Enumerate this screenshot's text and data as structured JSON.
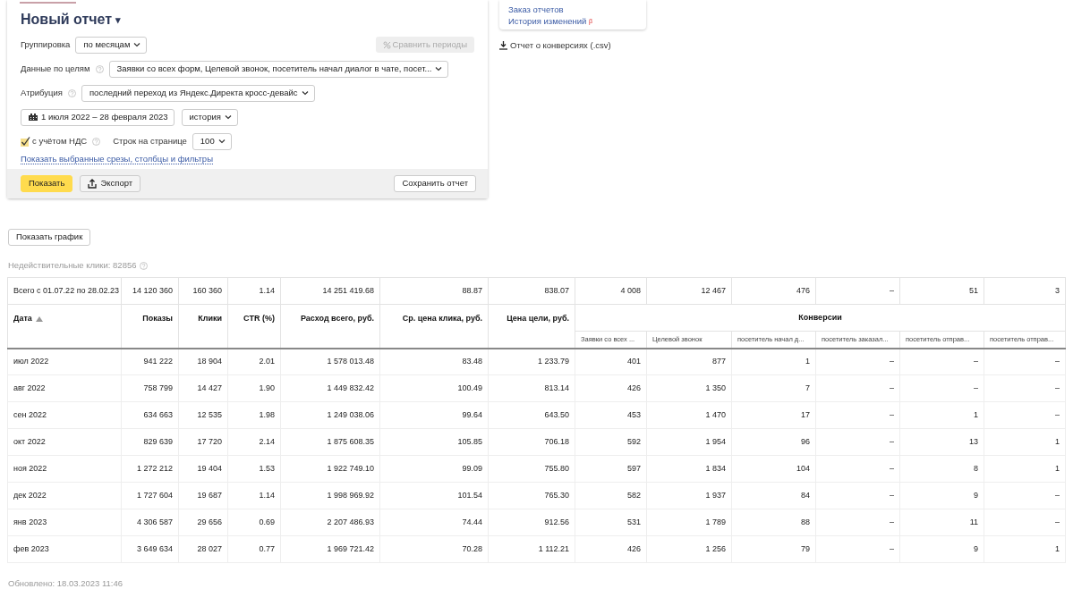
{
  "report": {
    "title": "Новый отчет",
    "title_caret": "▾"
  },
  "filters": {
    "grouping": {
      "label": "Группировка",
      "value": "по месяцам"
    },
    "compare_button": {
      "label": "Сравнить периоды",
      "disabled": true
    },
    "goals": {
      "label": "Данные по целям",
      "value": "Заявки со всех форм, Целевой звонок, посетитель начал диалог в чате, посет..."
    },
    "attribution": {
      "label": "Атрибуция",
      "value": "последний переход из Яндекс.Директа кросс-девайс"
    },
    "date_range": "1 июля 2022 – 28 февраля 2023",
    "period_mode": "история",
    "vat": {
      "label": "с учётом НДС",
      "checked": true
    },
    "rows_per_page": {
      "label": "Строк на странице",
      "value": "100"
    },
    "details_link": "Показать выбранные срезы, столбцы и фильтры"
  },
  "actions": {
    "show": "Показать",
    "export": "Экспорт",
    "save": "Сохранить отчет"
  },
  "side_links": [
    {
      "text": "Заказ отчетов"
    },
    {
      "text": "История изменений",
      "badge": "β"
    }
  ],
  "csv_link": "Отчет о конверсиях (.csv)",
  "show_chart_button": "Показать график",
  "invalid_clicks": "Недействительные клики: 82856",
  "table": {
    "columns": [
      {
        "label": "Дата",
        "sorted": true
      },
      {
        "label": "Показы",
        "sorted": false
      },
      {
        "label": "Клики",
        "sorted": false
      },
      {
        "label": "CTR (%)",
        "sorted": false
      },
      {
        "label": "Расход всего, руб.",
        "sorted": false
      },
      {
        "label": "Ср. цена клика, руб.",
        "sorted": false
      },
      {
        "label": "Цена цели, руб.",
        "sorted": false
      }
    ],
    "group_header": "Конверсии",
    "subcolumns": [
      "Заявки со всех ...",
      "Целевой звонок",
      "посетитель начал д...",
      "посетитель заказал...",
      "посетитель отправ...",
      "посетитель отправ..."
    ],
    "totals": [
      "Всего с 01.07.22 по 28.02.23",
      "14 120 360",
      "160 360",
      "1.14",
      "14 251 419.68",
      "88.87",
      "838.07",
      "4 008",
      "12 467",
      "476",
      "–",
      "51",
      "3"
    ],
    "rows": [
      [
        "июл 2022",
        "941 222",
        "18 904",
        "2.01",
        "1 578 013.48",
        "83.48",
        "1 233.79",
        "401",
        "877",
        "1",
        "–",
        "–",
        "–"
      ],
      [
        "авг 2022",
        "758 799",
        "14 427",
        "1.90",
        "1 449 832.42",
        "100.49",
        "813.14",
        "426",
        "1 350",
        "7",
        "–",
        "–",
        "–"
      ],
      [
        "сен 2022",
        "634 663",
        "12 535",
        "1.98",
        "1 249 038.06",
        "99.64",
        "643.50",
        "453",
        "1 470",
        "17",
        "–",
        "1",
        "–"
      ],
      [
        "окт 2022",
        "829 639",
        "17 720",
        "2.14",
        "1 875 608.35",
        "105.85",
        "706.18",
        "592",
        "1 954",
        "96",
        "–",
        "13",
        "1"
      ],
      [
        "ноя 2022",
        "1 272 212",
        "19 404",
        "1.53",
        "1 922 749.10",
        "99.09",
        "755.80",
        "597",
        "1 834",
        "104",
        "–",
        "8",
        "1"
      ],
      [
        "дек 2022",
        "1 727 604",
        "19 687",
        "1.14",
        "1 998 969.92",
        "101.54",
        "765.30",
        "582",
        "1 937",
        "84",
        "–",
        "9",
        "–"
      ],
      [
        "янв 2023",
        "4 306 587",
        "29 656",
        "0.69",
        "2 207 486.93",
        "74.44",
        "912.56",
        "531",
        "1 789",
        "88",
        "–",
        "11",
        "–"
      ],
      [
        "фев 2023",
        "3 649 634",
        "28 027",
        "0.77",
        "1 969 721.42",
        "70.28",
        "1 112.21",
        "426",
        "1 256",
        "79",
        "–",
        "9",
        "1"
      ]
    ]
  },
  "updated": "Обновлено: 18.03.2023 11:46"
}
